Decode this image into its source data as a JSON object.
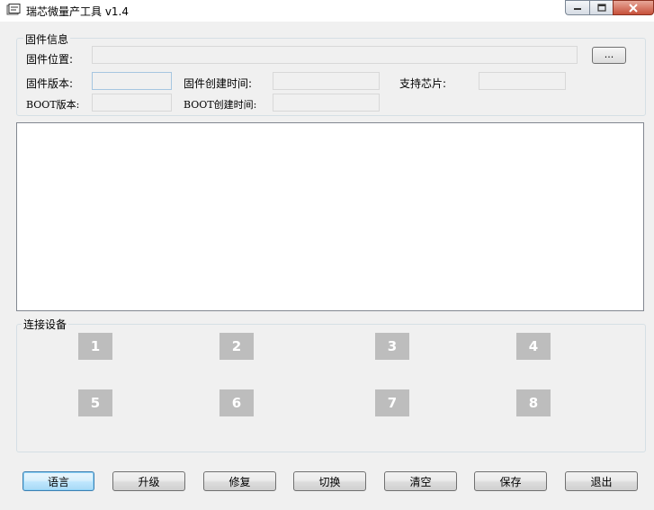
{
  "window": {
    "title": "瑞芯微量产工具 v1.4"
  },
  "firmware_info": {
    "group_title": "固件信息",
    "location_label": "固件位置:",
    "location_value": "",
    "browse_label": "...",
    "version_label": "固件版本:",
    "version_value": "",
    "created_label": "固件创建时间:",
    "created_value": "",
    "chip_label": "支持芯片:",
    "chip_value": "",
    "boot_version_label": "BOOT版本:",
    "boot_version_value": "",
    "boot_created_label": "BOOT创建时间:",
    "boot_created_value": ""
  },
  "log": {
    "text": ""
  },
  "devices": {
    "group_title": "连接设备",
    "slots": [
      "1",
      "2",
      "3",
      "4",
      "5",
      "6",
      "7",
      "8"
    ]
  },
  "buttons": {
    "language": "语言",
    "upgrade": "升级",
    "repair": "修复",
    "switch": "切换",
    "clear": "清空",
    "save": "保存",
    "exit": "退出"
  },
  "colors": {
    "slot_bg": "#bdbdbd",
    "close_btn": "#c7503a"
  },
  "icons": [
    "app-icon",
    "minimize-icon",
    "maximize-icon",
    "close-icon"
  ]
}
